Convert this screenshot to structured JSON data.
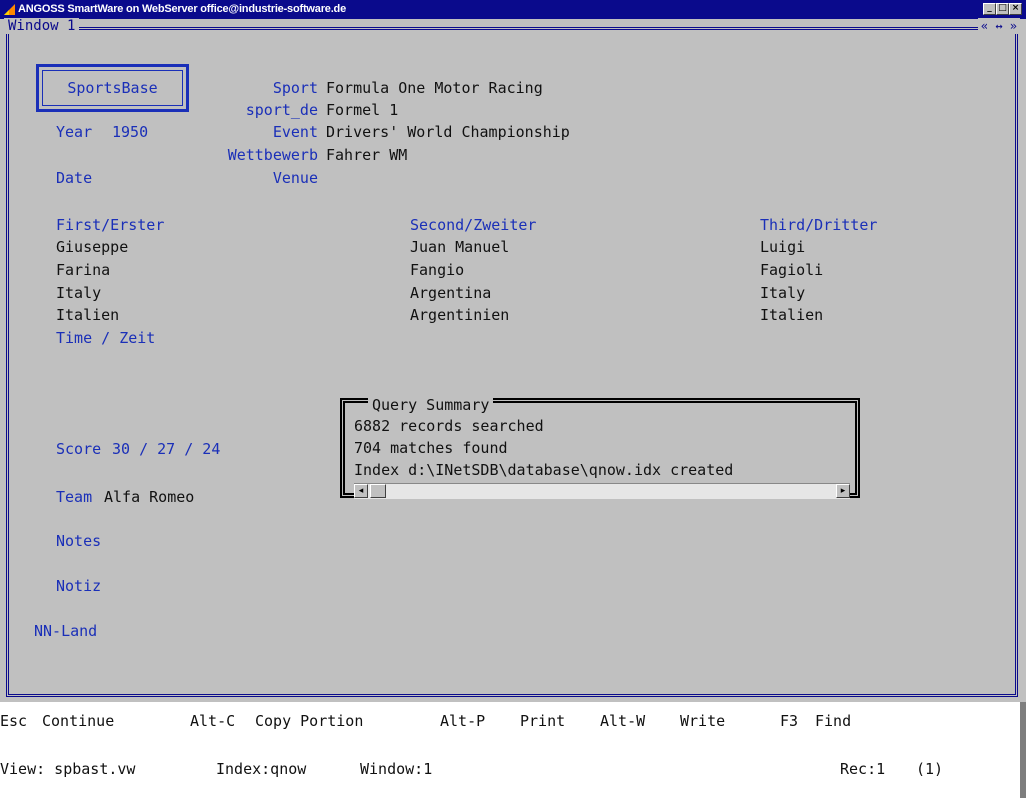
{
  "window": {
    "app_title": "ANGOSS SmartWare on WebServer office@industrie-software.de",
    "window_label": "Window 1",
    "window_controls": "« ↔ »"
  },
  "record": {
    "sportsbase_label": "SportsBase",
    "year_label": "Year",
    "year_value": "1950",
    "date_label": "Date",
    "sport_label": "Sport",
    "sport_value": "Formula One Motor Racing",
    "sport_de_label": "sport_de",
    "sport_de_value": "Formel 1",
    "event_label": "Event",
    "event_value": "Drivers' World Championship",
    "wettbewerb_label": "Wettbewerb",
    "wettbewerb_value": "Fahrer WM",
    "venue_label": "Venue",
    "venue_value": ""
  },
  "places": [
    {
      "header": "First/Erster",
      "first_name": "Giuseppe",
      "last_name": "Farina",
      "country": "Italy",
      "country_de": "Italien"
    },
    {
      "header": "Second/Zweiter",
      "first_name": "Juan Manuel",
      "last_name": "Fangio",
      "country": "Argentina",
      "country_de": "Argentinien"
    },
    {
      "header": "Third/Dritter",
      "first_name": "Luigi",
      "last_name": "Fagioli",
      "country": "Italy",
      "country_de": "Italien"
    }
  ],
  "details": {
    "time_label": "Time / Zeit",
    "score_label": "Score",
    "score_value": "30 / 27 / 24",
    "team_label": "Team",
    "team_value": "Alfa Romeo",
    "notes_label": "Notes",
    "notiz_label": "Notiz",
    "nn_land_label": "NN-Land"
  },
  "query_summary": {
    "title": "Query Summary",
    "line1": "6882 records searched",
    "line2": "704 matches found",
    "line3": "Index d:\\INetSDB\\database\\qnow.idx created"
  },
  "commands": [
    {
      "key": "Esc",
      "label": "Continue"
    },
    {
      "key": "Alt-C",
      "label": "Copy Portion"
    },
    {
      "key": "Alt-P",
      "label": "Print"
    },
    {
      "key": "Alt-W",
      "label": "Write"
    },
    {
      "key": "F3",
      "label": "Find"
    }
  ],
  "status": {
    "view": "View: spbast.vw",
    "index": "Index:qnow",
    "window": "Window:1",
    "rec": "Rec:1",
    "count": "(1)"
  },
  "colors": {
    "title_bar": "#0a0a8c",
    "field_label": "#1a2fb8",
    "background": "#c0c0c0"
  }
}
